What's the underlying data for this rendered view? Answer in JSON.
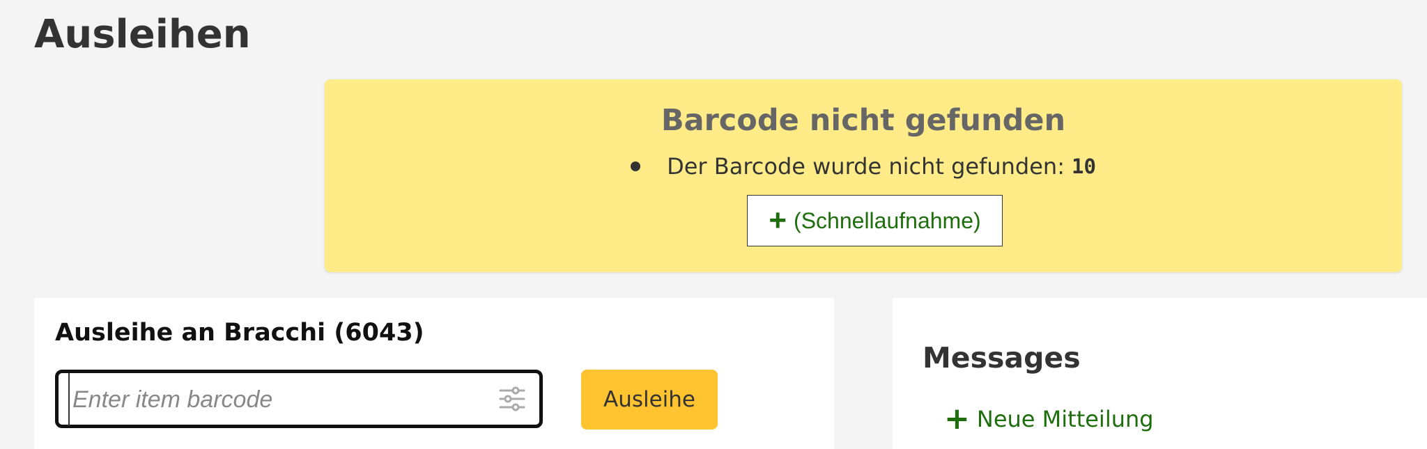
{
  "page": {
    "title": "Ausleihen"
  },
  "alert": {
    "title": "Barcode nicht gefunden",
    "message": "Der Barcode wurde nicht gefunden:",
    "barcode": "10",
    "quick_add_label": "(Schnellaufnahme)",
    "background": "#ffec88"
  },
  "checkout": {
    "heading": "Ausleihe an Bracchi (6043)",
    "barcode_placeholder": "Enter item barcode",
    "barcode_value": "",
    "submit_label": "Ausleihe",
    "submit_color": "#ffc430"
  },
  "messages": {
    "title": "Messages",
    "new_message_label": "Neue Mitteilung"
  },
  "icons": {
    "quick_add": "plus-icon",
    "new_message": "plus-icon",
    "barcode_settings": "sliders-icon"
  }
}
